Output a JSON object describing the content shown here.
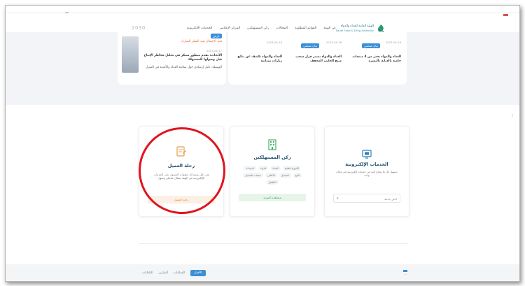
{
  "header": {
    "logo_ar": "الهيئة العامة للغذاء والدواء",
    "logo_en": "Saudi Food & Drug Authority",
    "brand_left": "2030",
    "nav": [
      "عن الهيئة",
      "القوائم المطلوبة",
      "المجالات",
      "ركن المستهلكين",
      "المركز الإعلامي",
      "الخدمات الإلكترونية"
    ]
  },
  "news_left": {
    "tag": "عرض",
    "headline": "قبل الإحتفال بعيد الفطر المبارك",
    "item1": "الأبحاث: نقدم منظور مبتكر في تحليل مخاطر الإنتاج قبل وصولها للمستهلك",
    "item2": "الوسيلة: دليل إرشادي حول سلامة الغذاء والأغذية في المنزل",
    "date": "2023-04-17"
  },
  "news_right": {
    "col1_tag": "بيان صحفي",
    "col1_text": "الغذاء والدواء تحذر من 4 منتجات خاصة بالعناية بالبشرة",
    "col1_date": "2023-04-16",
    "col2_tag": "بيان صحفي",
    "col2_text": "الغذاء والدواء تصدر قرار سحب منتج الحليب المجفف",
    "col2_date": "2023-04-16",
    "col3_text": "الغذاء والدواء تكشف عن نتائج زيارات ميدانية",
    "col3_date": "2023-04-16"
  },
  "cards": {
    "journey": {
      "title": "رحلة العميل",
      "desc": "هي دليل يقدم لك خطوات الحصول على الخدمات الإلكترونية في الهيئة بشكل تفاعلي وسهل",
      "button": "رحلة العميل"
    },
    "consumer": {
      "title": "ركن المستهلكين",
      "chips": [
        "الأجهزة الطبية",
        "الغذاء",
        "الدواء",
        "المبيدات",
        "التبغ",
        "التجميل",
        "الأعلاف",
        "منتجات التجميل",
        "الأطفال"
      ],
      "button": "مشاهدة المزيد"
    },
    "eservices": {
      "title": "الخدمات الإلكترونية",
      "desc": "تسهيل كل ما يحتاج إليه من خدمات إلكترونية في مكان واحد",
      "select": "اختر خدمة"
    }
  },
  "bottom": {
    "tabs": [
      "الأخبار",
      "الفعاليات",
      "التقارير",
      "الإعلانات"
    ],
    "right": "..."
  },
  "colors": {
    "accent": "#3b8fd6",
    "circle": "#e0141e",
    "orange": "#e08a3c",
    "green": "#3a9a58"
  }
}
